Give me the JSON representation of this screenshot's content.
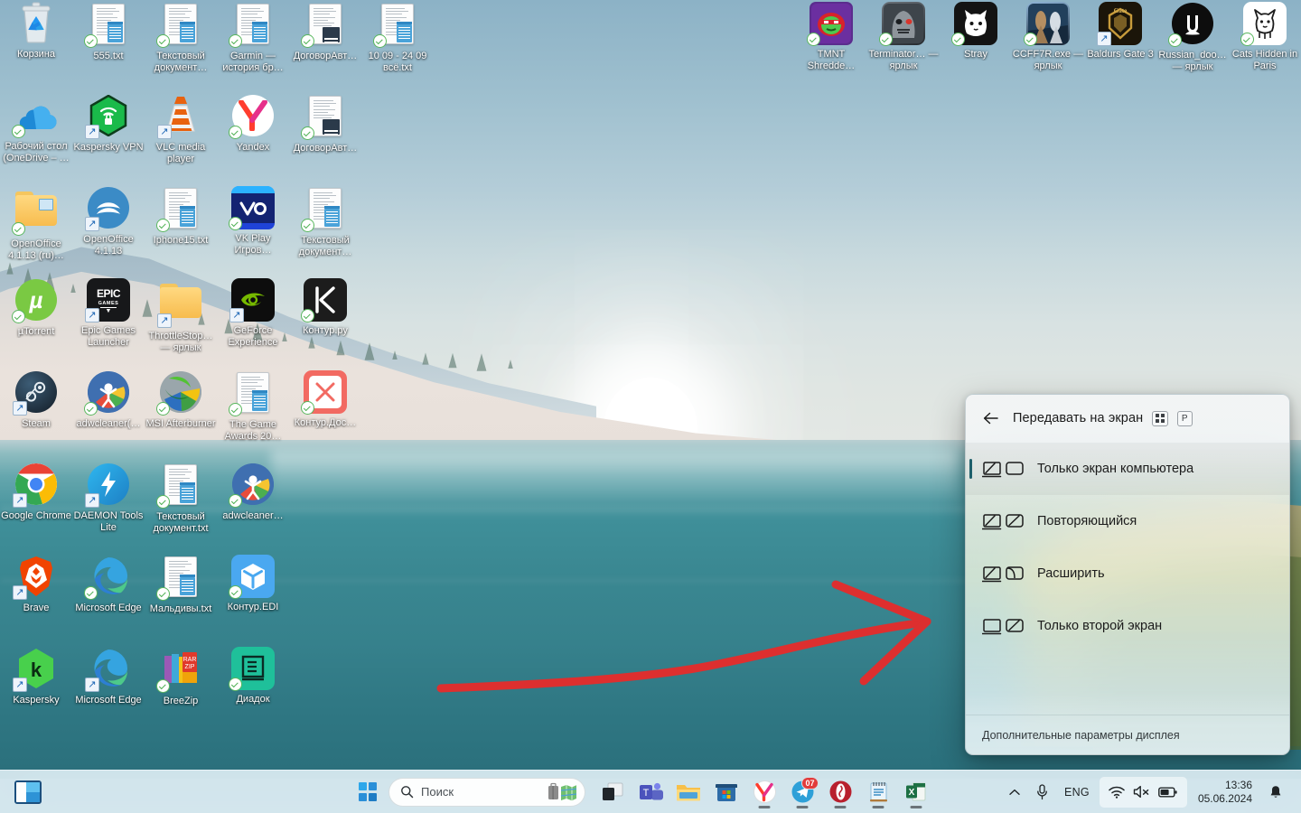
{
  "desktop": {
    "icons_col1": [
      {
        "label": "Корзина",
        "icon": "recycle-bin-icon",
        "type": "bin",
        "overlay": "none"
      },
      {
        "label": "Рабочий стол (OneDrive – …",
        "icon": "onedrive-folder-icon",
        "type": "onedrive",
        "overlay": "check"
      },
      {
        "label": "OpenOffice 4.1.13 (ru)…",
        "icon": "folder-icon",
        "type": "folder-media",
        "overlay": "check"
      },
      {
        "label": "µTorrent",
        "icon": "utorrent-icon",
        "type": "utorrent",
        "overlay": "check"
      },
      {
        "label": "Steam",
        "icon": "steam-icon",
        "type": "steam",
        "overlay": "shortcut"
      },
      {
        "label": "Google Chrome",
        "icon": "chrome-icon",
        "type": "chrome",
        "overlay": "shortcut"
      },
      {
        "label": "Brave",
        "icon": "brave-icon",
        "type": "brave",
        "overlay": "shortcut"
      },
      {
        "label": "Kaspersky",
        "icon": "kaspersky-icon",
        "type": "kaspersky",
        "overlay": "shortcut"
      }
    ],
    "icons_col2": [
      {
        "label": "555.txt",
        "icon": "text-document-icon",
        "type": "doc",
        "overlay": "check"
      },
      {
        "label": "Kaspersky VPN",
        "icon": "kaspersky-vpn-icon",
        "type": "kvpn",
        "overlay": "shortcut"
      },
      {
        "label": "OpenOffice 4.1.13",
        "icon": "openoffice-icon",
        "type": "openoffice",
        "overlay": "shortcut"
      },
      {
        "label": "Epic Games Launcher",
        "icon": "epic-games-icon",
        "type": "epic",
        "overlay": "shortcut"
      },
      {
        "label": "adwcleaner(…",
        "icon": "adwcleaner-icon",
        "type": "adw",
        "overlay": "check"
      },
      {
        "label": "DAEMON Tools Lite",
        "icon": "daemon-tools-icon",
        "type": "daemon",
        "overlay": "shortcut"
      },
      {
        "label": "Microsoft Edge",
        "icon": "edge-icon",
        "type": "edge",
        "overlay": "check"
      },
      {
        "label": "Microsoft Edge",
        "icon": "edge-icon",
        "type": "edge",
        "overlay": "shortcut"
      }
    ],
    "icons_col3": [
      {
        "label": "Текстовый документ…",
        "icon": "text-document-icon",
        "type": "doc",
        "overlay": "check"
      },
      {
        "label": "VLC media player",
        "icon": "vlc-icon",
        "type": "vlc",
        "overlay": "shortcut"
      },
      {
        "label": "Iphone15.txt",
        "icon": "text-document-icon",
        "type": "doc",
        "overlay": "check"
      },
      {
        "label": "ThrottleStop… — ярлык",
        "icon": "folder-icon",
        "type": "folder",
        "overlay": "shortcut"
      },
      {
        "label": "MSI Afterburner",
        "icon": "msi-afterburner-icon",
        "type": "msi",
        "overlay": "check"
      },
      {
        "label": "Текстовый документ.txt",
        "icon": "text-document-icon",
        "type": "doc",
        "overlay": "check"
      },
      {
        "label": "Мальдивы.txt",
        "icon": "text-document-icon",
        "type": "doc",
        "overlay": "check"
      },
      {
        "label": "BreeZip",
        "icon": "breezip-icon",
        "type": "breezip",
        "overlay": "check"
      }
    ],
    "icons_col4": [
      {
        "label": "Garmin — история бр…",
        "icon": "text-document-icon",
        "type": "doc",
        "overlay": "check"
      },
      {
        "label": "Yandex",
        "icon": "yandex-icon",
        "type": "yandex",
        "overlay": "check"
      },
      {
        "label": "VK Play Игров…",
        "icon": "vk-play-icon",
        "type": "vkplay",
        "overlay": "check"
      },
      {
        "label": "GeForce Experience",
        "icon": "geforce-icon",
        "type": "geforce",
        "overlay": "shortcut"
      },
      {
        "label": "The Game Awards 20…",
        "icon": "text-document-icon",
        "type": "doc",
        "overlay": "check"
      },
      {
        "label": "adwcleaner…",
        "icon": "adwcleaner-icon",
        "type": "adw",
        "overlay": "check"
      },
      {
        "label": "Контур.EDI",
        "icon": "kontur-edi-icon",
        "type": "konturedi",
        "overlay": "check"
      },
      {
        "label": "Диадок",
        "icon": "diadoc-icon",
        "type": "diadoc",
        "overlay": "check"
      }
    ],
    "icons_col5": [
      {
        "label": "ДоговорАвт…",
        "icon": "word-document-icon",
        "type": "docword",
        "overlay": "check"
      },
      {
        "label": "ДоговорАвт…",
        "icon": "word-document-icon",
        "type": "docword",
        "overlay": "check"
      },
      {
        "label": "Текстовый документ…",
        "icon": "text-document-icon",
        "type": "doc",
        "overlay": "check"
      },
      {
        "label": "Контур.ру",
        "icon": "kontur-icon",
        "type": "kontur",
        "overlay": "check"
      },
      {
        "label": "Контур.Дос…",
        "icon": "kontur-docs-icon",
        "type": "konturdoc",
        "overlay": "check"
      }
    ],
    "icons_col6": [
      {
        "label": "10 09 - 24 09 всё.txt",
        "icon": "text-document-icon",
        "type": "doc",
        "overlay": "check"
      }
    ],
    "icons_topright": [
      {
        "label": "TMNT Shredde…",
        "icon": "tmnt-icon",
        "type": "tmnt",
        "overlay": "check"
      },
      {
        "label": "Terminator… — ярлык",
        "icon": "terminator-icon",
        "type": "terminator",
        "overlay": "check"
      },
      {
        "label": "Stray",
        "icon": "stray-icon",
        "type": "stray",
        "overlay": "check"
      },
      {
        "label": "CCFF7R.exe — ярлык",
        "icon": "ff7-icon",
        "type": "ff7",
        "overlay": "check"
      },
      {
        "label": "Baldurs Gate 3",
        "icon": "baldurs-gate-icon",
        "type": "bg3",
        "overlay": "shortcut"
      },
      {
        "label": "Russian_doo… — ярлык",
        "icon": "unreal-engine-icon",
        "type": "unreal",
        "overlay": "check"
      },
      {
        "label": "Cats Hidden in Paris",
        "icon": "cats-hidden-icon",
        "type": "cats",
        "overlay": "check"
      }
    ]
  },
  "project_panel": {
    "title": "Передавать на экран",
    "back_icon": "back-arrow-icon",
    "shortcut_keys": [
      "windows-key",
      "P"
    ],
    "shortcut_p": "P",
    "items": [
      {
        "label": "Только экран компьютера",
        "selected": true,
        "mode": "pc-screen-only"
      },
      {
        "label": "Повторяющийся",
        "selected": false,
        "mode": "duplicate"
      },
      {
        "label": "Расширить",
        "selected": false,
        "mode": "extend"
      },
      {
        "label": "Только второй экран",
        "selected": false,
        "mode": "second-screen-only"
      }
    ],
    "footer_link": "Дополнительные параметры дисплея",
    "accent_color": "#1d5f6b"
  },
  "annotation": {
    "type": "hand-drawn-arrow",
    "color": "#dd2f2f",
    "direction": "right"
  },
  "taskbar": {
    "widgets_icon": "widgets-icon",
    "start_icon": "windows-start-icon",
    "search": {
      "placeholder": "Поиск",
      "value": "",
      "icon": "search-icon",
      "illustration": "suitcase-map-icon"
    },
    "apps": [
      {
        "name": "task-view",
        "label": "Представление задач",
        "running": false,
        "badge": ""
      },
      {
        "name": "microsoft-teams",
        "label": "Microsoft Teams",
        "running": false,
        "badge": ""
      },
      {
        "name": "file-explorer",
        "label": "Проводник",
        "running": false,
        "badge": ""
      },
      {
        "name": "microsoft-store",
        "label": "Microsoft Store",
        "running": false,
        "badge": ""
      },
      {
        "name": "yandex-browser",
        "label": "Yandex",
        "running": true,
        "badge": ""
      },
      {
        "name": "telegram",
        "label": "Telegram",
        "running": true,
        "badge": "07"
      },
      {
        "name": "opera-gx",
        "label": "Opera",
        "running": true,
        "badge": ""
      },
      {
        "name": "notepad",
        "label": "Блокнот",
        "running": true,
        "badge": ""
      },
      {
        "name": "excel",
        "label": "Excel",
        "running": true,
        "badge": ""
      }
    ],
    "tray": {
      "chevron_icon": "chevron-up-icon",
      "mic_icon": "microphone-icon",
      "language": "ENG",
      "wifi_icon": "wifi-icon",
      "volume_icon": "speaker-muted-icon",
      "battery_icon": "battery-icon",
      "time": "13:36",
      "date": "05.06.2024",
      "notification_icon": "bell-icon"
    }
  }
}
